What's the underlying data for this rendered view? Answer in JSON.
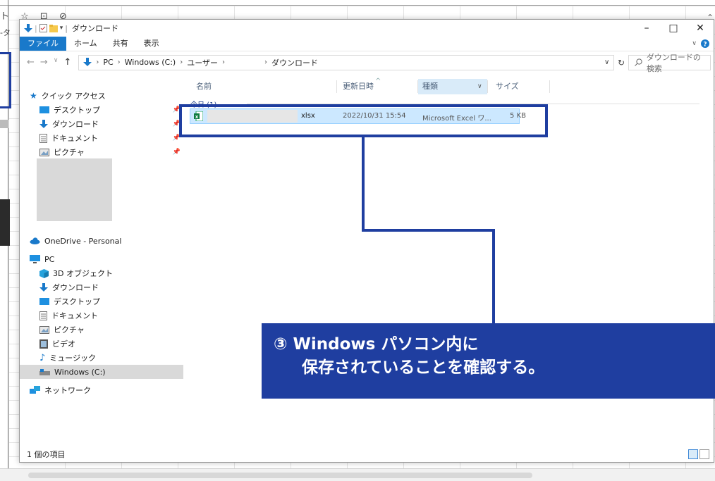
{
  "window": {
    "title": "ダウンロード",
    "title_sep": "|",
    "controls": {
      "minimize": "–",
      "maximize": "□",
      "close": "✕"
    }
  },
  "ribbon": {
    "tabs": [
      "ファイル",
      "ホーム",
      "共有",
      "表示"
    ],
    "active_tab": "ファイル"
  },
  "address": {
    "segments": [
      "PC",
      "Windows (C:)",
      "ユーザー",
      "ダウンロード"
    ],
    "separator": "›"
  },
  "search": {
    "placeholder": "ダウンロードの検索"
  },
  "nav": {
    "quick_access": "クイック アクセス",
    "quick_items": [
      "デスクトップ",
      "ダウンロード",
      "ドキュメント",
      "ピクチャ"
    ],
    "onedrive": "OneDrive - Personal",
    "pc": "PC",
    "pc_items": [
      "3D オブジェクト",
      "ダウンロード",
      "デスクトップ",
      "ドキュメント",
      "ピクチャ",
      "ビデオ",
      "ミュージック",
      "Windows (C:)"
    ],
    "network": "ネットワーク"
  },
  "columns": {
    "name": "名前",
    "date": "更新日時",
    "type": "種類",
    "size": "サイズ"
  },
  "group": {
    "label": "今日 (1)"
  },
  "file": {
    "ext": "xlsx",
    "modified": "2022/10/31 15:54",
    "type": "Microsoft Excel ワ...",
    "size": "5 KB"
  },
  "status": {
    "count": "1 個の項目"
  },
  "annotation": {
    "line1": "③ Windows パソコン内に",
    "line2": "保存されていることを確認する。"
  },
  "background": {
    "quick_icons": "ト ☆ ⊡ ⊘",
    "side_label": "-タ"
  },
  "colors": {
    "accent": "#1979ca",
    "annotation": "#1f3ea0",
    "selection": "#cce8ff"
  }
}
